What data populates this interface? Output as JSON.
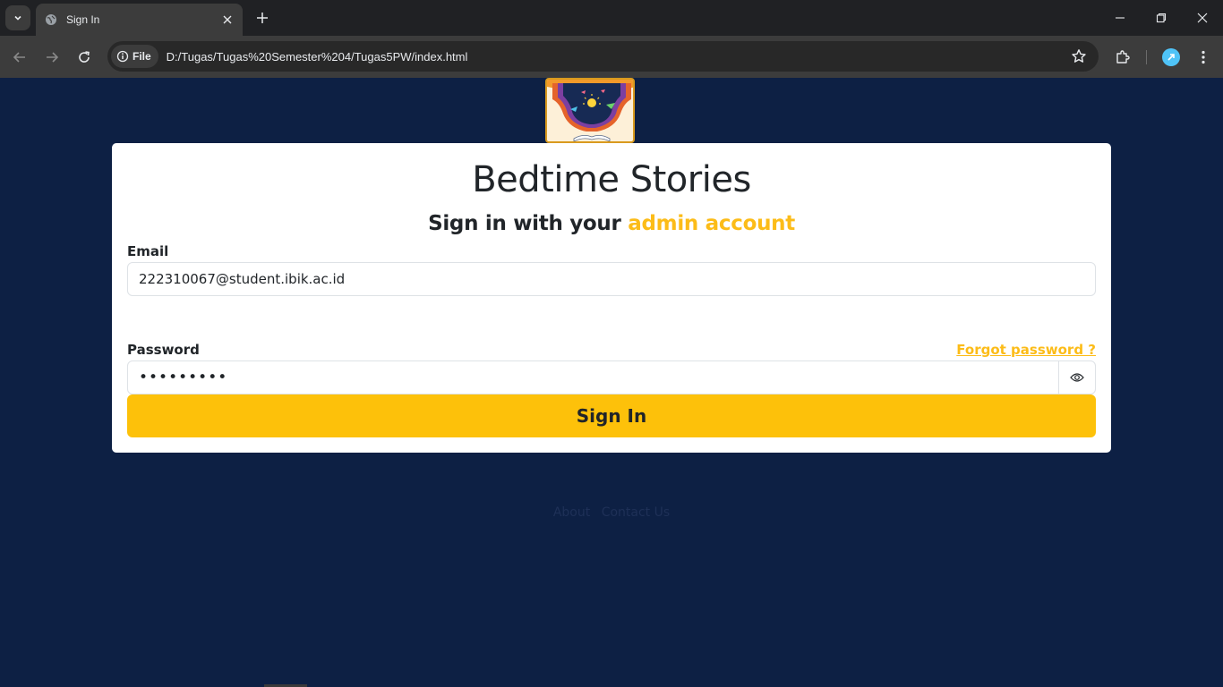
{
  "browser": {
    "tab_title": "Sign In",
    "chip_label": "File",
    "url": "D:/Tugas/Tugas%20Semester%204/Tugas5PW/index.html"
  },
  "page": {
    "title": "Bedtime Stories",
    "subtitle_prefix": "Sign in with your",
    "subtitle_highlight": "admin account",
    "email_label": "Email",
    "email_value": "222310067@student.ibik.ac.id",
    "password_label": "Password",
    "password_value": "•••••••••",
    "forgot_link": "Forgot password ?",
    "signin_button": "Sign In",
    "footer_links": [
      "About",
      "Contact Us"
    ]
  },
  "colors": {
    "background": "#0d2044",
    "accent": "#fcbc18",
    "button": "#fdc10a"
  }
}
